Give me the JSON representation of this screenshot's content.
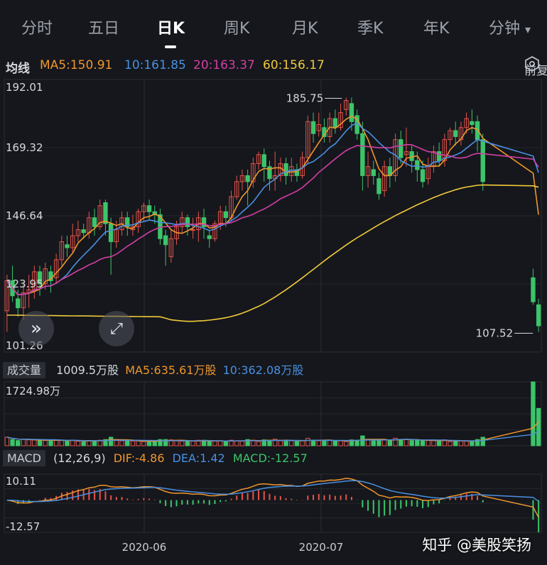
{
  "tabs": [
    "分时",
    "五日",
    "日K",
    "周K",
    "月K",
    "季K",
    "年K",
    "分钟"
  ],
  "active_tab": "日K",
  "dropdown_arrow": "▾",
  "ma_bar": {
    "title": "均线",
    "ma5": "MA5:150.91",
    "ma10": "10:161.85",
    "ma20": "20:163.37",
    "ma60": "60:156.17",
    "adjust": "前复权"
  },
  "volume_bar": {
    "title": "成交量",
    "vol": "1009.5万股",
    "ma5": "MA5:635.61万股",
    "ma10": "10:362.08万股"
  },
  "macd_bar": {
    "title": "MACD",
    "params": "(12,26,9)",
    "dif": "DIF:-4.86",
    "dea": "DEA:1.42",
    "macd": "MACD:-12.57"
  },
  "watermark": "知乎 @美股笑扬",
  "colors": {
    "up": "#e5534b",
    "down": "#3cc46a",
    "ma5": "#f0962d",
    "ma10": "#4a90e2",
    "ma20": "#d23fa6",
    "ma60": "#f0c93a"
  },
  "chart_data": [
    {
      "type": "candlestick",
      "ytick_labels": [
        "192.01",
        "169.32",
        "146.64",
        "123.95",
        "101.26"
      ],
      "ylim": [
        101.26,
        192.01
      ],
      "xtick_labels": [
        "2020-06",
        "2020-07"
      ],
      "annotations": {
        "high": "185.75",
        "low": "107.52"
      },
      "candles": [
        [
          115,
          125,
          108,
          127
        ],
        [
          125,
          120,
          118,
          130
        ],
        [
          119,
          116,
          113,
          122
        ],
        [
          116,
          121,
          112,
          124
        ],
        [
          121,
          122,
          116,
          127
        ],
        [
          122,
          128,
          119,
          130
        ],
        [
          128,
          124,
          120,
          130
        ],
        [
          124,
          129,
          122,
          131
        ],
        [
          128,
          125,
          121,
          130
        ],
        [
          126,
          132,
          124,
          134
        ],
        [
          132,
          138,
          130,
          140
        ],
        [
          137,
          136,
          133,
          140
        ],
        [
          136,
          140,
          134,
          144
        ],
        [
          140,
          142,
          138,
          145
        ],
        [
          142,
          141,
          139,
          144
        ],
        [
          141,
          146,
          139,
          148
        ],
        [
          146,
          143,
          140,
          149
        ],
        [
          143,
          150,
          142,
          152
        ],
        [
          151,
          144,
          140,
          152
        ],
        [
          144,
          138,
          127,
          146
        ],
        [
          138,
          142,
          136,
          145
        ],
        [
          142,
          146,
          140,
          148
        ],
        [
          146,
          143,
          140,
          148
        ],
        [
          142,
          143,
          140,
          147
        ],
        [
          143,
          148,
          141,
          149
        ],
        [
          148,
          150,
          145,
          151
        ],
        [
          150,
          148,
          145,
          152
        ],
        [
          148,
          147,
          144,
          150
        ],
        [
          147,
          139,
          137,
          149
        ],
        [
          140,
          137,
          130,
          142
        ],
        [
          133,
          139,
          131,
          142
        ],
        [
          139,
          143,
          137,
          145
        ],
        [
          143,
          146,
          141,
          148
        ],
        [
          146,
          143,
          140,
          147
        ],
        [
          142,
          142,
          139,
          146
        ],
        [
          142,
          146,
          138,
          148
        ],
        [
          146,
          143,
          139,
          149
        ],
        [
          140,
          139,
          136,
          142
        ],
        [
          139,
          144,
          138,
          145
        ],
        [
          144,
          148,
          142,
          150
        ],
        [
          148,
          146,
          143,
          150
        ],
        [
          146,
          153,
          145,
          155
        ],
        [
          153,
          158,
          152,
          160
        ],
        [
          158,
          160,
          155,
          162
        ],
        [
          160,
          158,
          150,
          162
        ],
        [
          158,
          164,
          156,
          166
        ],
        [
          164,
          167,
          162,
          168
        ],
        [
          167,
          163,
          158,
          169
        ],
        [
          163,
          159,
          155,
          165
        ],
        [
          159,
          160,
          155,
          168
        ],
        [
          160,
          164,
          158,
          166
        ],
        [
          164,
          160,
          157,
          166
        ],
        [
          160,
          163,
          158,
          166
        ],
        [
          162,
          160,
          158,
          164
        ],
        [
          160,
          166,
          159,
          168
        ],
        [
          166,
          178,
          164,
          180
        ],
        [
          178,
          174,
          171,
          181
        ],
        [
          175,
          177,
          173,
          181
        ],
        [
          176,
          173,
          171,
          179
        ],
        [
          173,
          179,
          171,
          181
        ],
        [
          179,
          176,
          174,
          182
        ],
        [
          176,
          181,
          175,
          184
        ],
        [
          182,
          185,
          180,
          186
        ],
        [
          184,
          178,
          175,
          186
        ],
        [
          180,
          174,
          172,
          182
        ],
        [
          174,
          160,
          155,
          178
        ],
        [
          160,
          163,
          156,
          168
        ],
        [
          162,
          160,
          157,
          165
        ],
        [
          159,
          154,
          152,
          161
        ],
        [
          155,
          163,
          153,
          165
        ],
        [
          163,
          160,
          156,
          166
        ],
        [
          160,
          172,
          158,
          174
        ],
        [
          172,
          166,
          164,
          175
        ],
        [
          167,
          168,
          163,
          176
        ],
        [
          168,
          165,
          161,
          170
        ],
        [
          165,
          162,
          158,
          168
        ],
        [
          162,
          158,
          156,
          165
        ],
        [
          159,
          163,
          157,
          166
        ],
        [
          163,
          168,
          161,
          170
        ],
        [
          168,
          165,
          163,
          171
        ],
        [
          165,
          172,
          163,
          174
        ],
        [
          172,
          175,
          170,
          176
        ],
        [
          175,
          173,
          170,
          178
        ],
        [
          172,
          176,
          170,
          178
        ],
        [
          176,
          179,
          174,
          181
        ],
        [
          178,
          177,
          174,
          182
        ],
        [
          178,
          172,
          168,
          180
        ],
        [
          172,
          158,
          155,
          174
        ],
        [
          126,
          118,
          117,
          129
        ],
        [
          117,
          110,
          108,
          119
        ]
      ],
      "ma60": [
        113,
        112.5,
        112,
        111.8,
        111.6,
        111.5,
        111.5,
        111.6,
        111.7,
        111.9,
        112.1,
        112.4,
        112.7,
        113.1,
        113.6,
        114.2,
        114.9,
        115.7,
        116.5,
        117.4,
        118.5,
        119.6,
        120.8,
        122,
        123.3,
        124.6,
        126,
        127.4,
        128.8,
        130.2,
        131.6,
        133,
        134.3,
        135.6,
        136.9,
        138.1,
        139.3,
        140.4,
        141.5,
        142.6,
        143.7,
        144.7,
        145.7,
        146.7,
        147.6,
        148.5,
        149.4,
        150.3,
        151.1,
        151.9,
        152.7,
        153.4,
        154.1,
        154.7,
        155.3,
        155.8,
        156.2,
        156.5,
        156.8,
        156.9,
        156.6,
        156.17
      ],
      "ma60_start": 28
    },
    {
      "type": "bar",
      "title": "volume",
      "ytick_labels": [
        "1724.98万"
      ],
      "unit": "万股",
      "latest": 1009.5,
      "max": 1724.98
    },
    {
      "type": "bar",
      "title": "MACD",
      "ytick_labels": [
        "10.11",
        "-12.57"
      ],
      "ylim": [
        -12.57,
        10.11
      ]
    }
  ]
}
